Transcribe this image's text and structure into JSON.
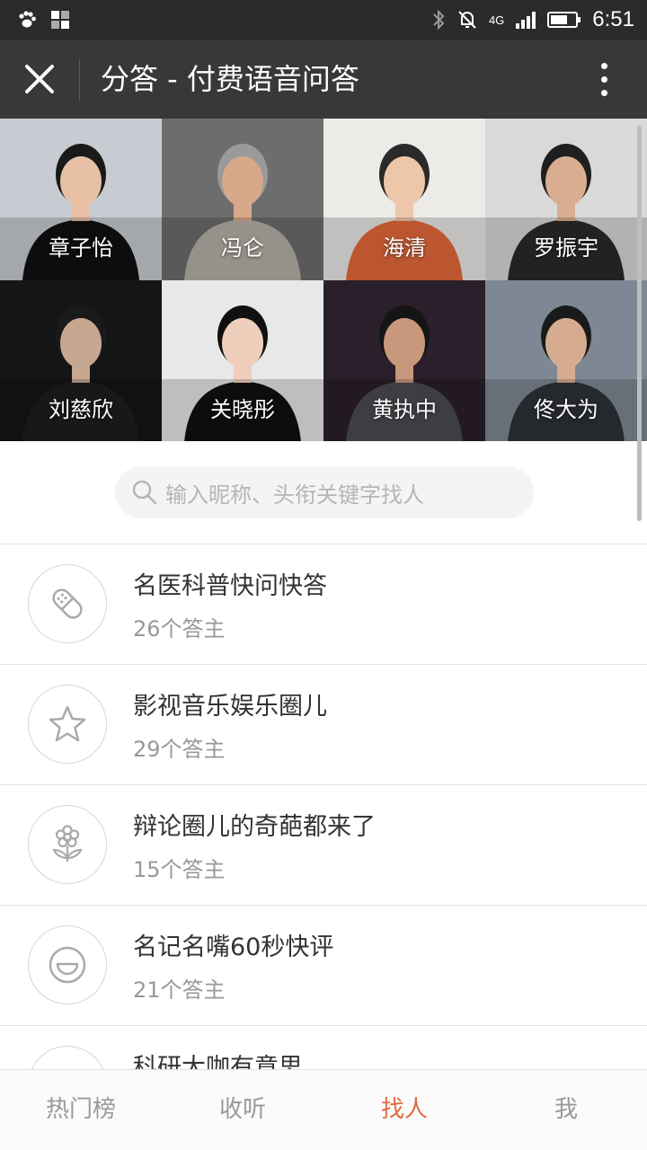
{
  "status_bar": {
    "network": "4G",
    "time": "6:51",
    "icons": [
      "paw-icon",
      "apps-icon",
      "bluetooth-icon",
      "mute-icon",
      "signal-icon",
      "battery-icon"
    ]
  },
  "title_bar": {
    "title": "分答 - 付费语音问答",
    "close_icon": "close-icon",
    "menu_icon": "more-vertical-icon"
  },
  "celebrities": [
    {
      "name": "章子怡",
      "bg": "#c8ccd2",
      "skin": "#e7c0a6",
      "hair": "#1a1a1a",
      "shirt": "#111111"
    },
    {
      "name": "冯仑",
      "bg": "#6d6d6d",
      "skin": "#d7a889",
      "hair": "#9a9a9a",
      "shirt": "#b7b2a8"
    },
    {
      "name": "海清",
      "bg": "#ecebe8",
      "skin": "#eec6aa",
      "hair": "#2a2a2a",
      "shirt": "#e46a3c"
    },
    {
      "name": "罗振宇",
      "bg": "#d9d9d9",
      "skin": "#d9ad8f",
      "hair": "#1f1f1f",
      "shirt": "#2a2a2a"
    },
    {
      "name": "刘慈欣",
      "bg": "#151515",
      "skin": "#c8a791",
      "hair": "#1a1a1a",
      "shirt": "#1e1e1e"
    },
    {
      "name": "关晓彤",
      "bg": "#e8e8e8",
      "skin": "#efcfbb",
      "hair": "#111111",
      "shirt": "#111111"
    },
    {
      "name": "黄执中",
      "bg": "#2a1f2a",
      "skin": "#c9977c",
      "hair": "#151515",
      "shirt": "#4b4b52"
    },
    {
      "name": "佟大为",
      "bg": "#7e8894",
      "skin": "#d6ac90",
      "hair": "#1a1a1a",
      "shirt": "#2e3138"
    }
  ],
  "search": {
    "placeholder": "输入昵称、头衔关键字找人",
    "icon": "search-icon"
  },
  "categories": [
    {
      "title": "名医科普快问快答",
      "count": "26个答主",
      "icon": "bandage-icon"
    },
    {
      "title": "影视音乐娱乐圈儿",
      "count": "29个答主",
      "icon": "star-icon"
    },
    {
      "title": "辩论圈儿的奇葩都来了",
      "count": "15个答主",
      "icon": "flower-icon"
    },
    {
      "title": "名记名嘴60秒快评",
      "count": "21个答主",
      "icon": "smile-icon"
    },
    {
      "title": "科研大咖有意思",
      "count": "",
      "icon": "science-icon"
    }
  ],
  "tabs": [
    {
      "label": "热门榜",
      "active": false
    },
    {
      "label": "收听",
      "active": false
    },
    {
      "label": "找人",
      "active": true
    },
    {
      "label": "我",
      "active": false
    }
  ],
  "colors": {
    "accent": "#e2683f",
    "title_bar": "#383838",
    "status_bar": "#2b2b2b"
  }
}
